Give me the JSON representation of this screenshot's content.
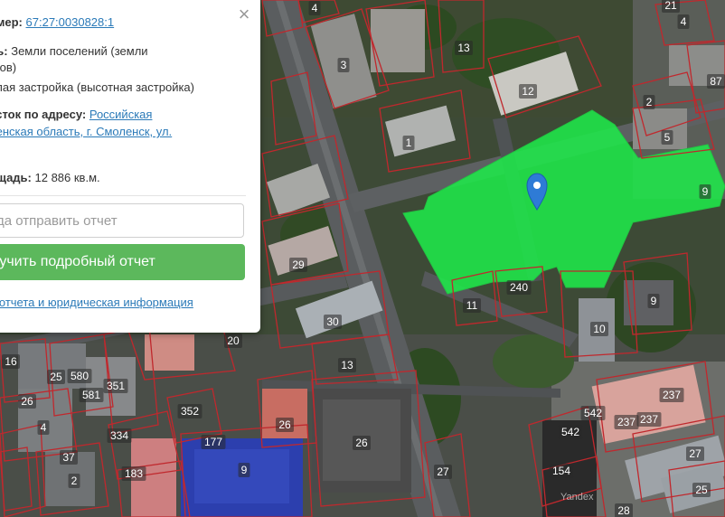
{
  "map": {
    "highlight_color": "#1fe84a",
    "parcel_border_color": "#c0282d",
    "marker_color": "#2e7bd6",
    "watermark": "Yandex",
    "parcel_numbers": [
      "4",
      "21",
      "4",
      "13",
      "3",
      "87",
      "12",
      "2",
      "5",
      "1",
      "9",
      "29",
      "240",
      "11",
      "9",
      "10",
      "30",
      "20",
      "16",
      "25",
      "580",
      "581",
      "351",
      "13",
      "26",
      "26",
      "4",
      "334",
      "352",
      "177",
      "26",
      "37",
      "2",
      "183",
      "9",
      "542",
      "237",
      "237",
      "237",
      "27",
      "542",
      "154",
      "27",
      "25",
      "28"
    ]
  },
  "popup": {
    "cadastral_label": "омер:",
    "cadastral_number": "67:27:0030828:1",
    "category_label": "ль:",
    "category_value": "Земли поселений (земли",
    "category_value_2": "ктов)",
    "category_value_3": "илая застройка (высотная застройка)",
    "address_label": "асток по адресу:",
    "address_value": "Российская",
    "address_value_2": "ленская область, г. Смоленск, ул.",
    "area_label": "ощадь:",
    "area_value": "12 886 кв.м.",
    "email_placeholder": "уда отправить отчет",
    "submit_label": "лучить подробный отчет",
    "footer_link": "и отчета и юридическая информация",
    "close_icon": "×"
  }
}
